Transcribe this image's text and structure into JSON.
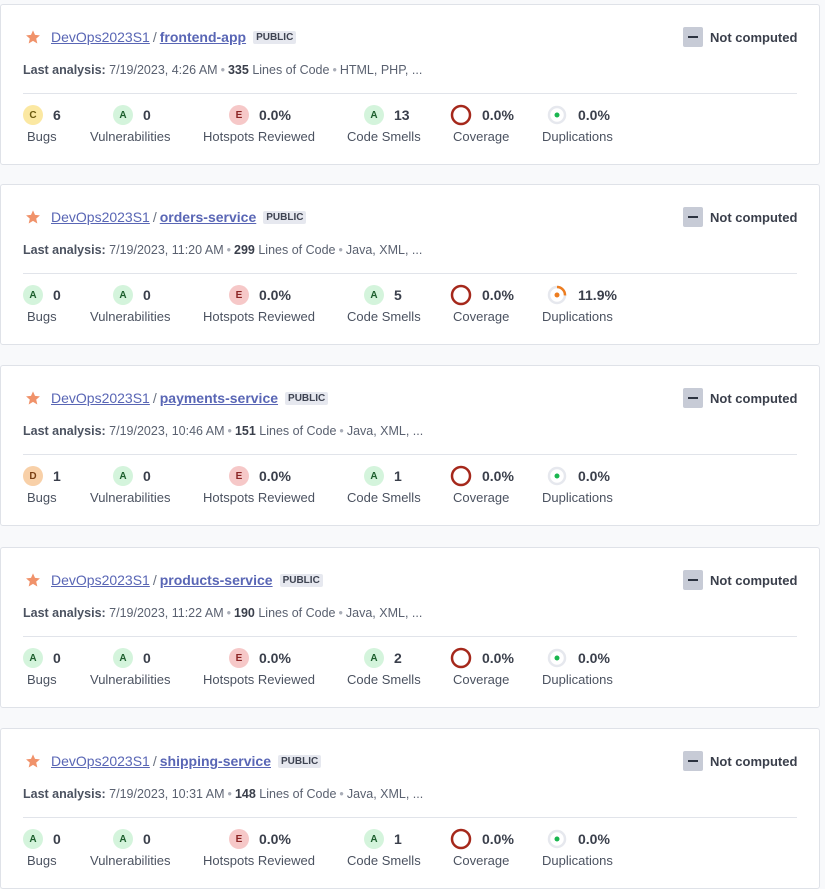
{
  "icons": {
    "favorite": "star-icon",
    "quality_gate": "minus-icon"
  },
  "colors": {
    "link": "#5966b5",
    "star": "#f0926a",
    "coverage": "#a5281b",
    "duplication_low": "#1ab64f",
    "duplication_warn": "#ed7d20"
  },
  "projects": [
    {
      "org": "DevOps2023S1",
      "name": "frontend-app",
      "visibility": "PUBLIC",
      "quality_gate": "Not computed",
      "last_label": "Last analysis:",
      "last": "7/19/2023, 4:26 AM",
      "loc": "335",
      "loc_label": "Lines of Code",
      "langs": "HTML, PHP, ...",
      "bugs_rating": "C",
      "bugs": "6",
      "bugs_label": "Bugs",
      "vuln_rating": "A",
      "vuln": "0",
      "vuln_label": "Vulnerabilities",
      "hot_rating": "E",
      "hot": "0.0%",
      "hot_label": "Hotspots Reviewed",
      "smell_rating": "A",
      "smell": "13",
      "smell_label": "Code Smells",
      "cov": "0.0%",
      "cov_label": "Coverage",
      "dup": "0.0%",
      "dup_pct": 0.0,
      "dup_label": "Duplications"
    },
    {
      "org": "DevOps2023S1",
      "name": "orders-service",
      "visibility": "PUBLIC",
      "quality_gate": "Not computed",
      "last_label": "Last analysis:",
      "last": "7/19/2023, 11:20 AM",
      "loc": "299",
      "loc_label": "Lines of Code",
      "langs": "Java, XML, ...",
      "bugs_rating": "A",
      "bugs": "0",
      "bugs_label": "Bugs",
      "vuln_rating": "A",
      "vuln": "0",
      "vuln_label": "Vulnerabilities",
      "hot_rating": "E",
      "hot": "0.0%",
      "hot_label": "Hotspots Reviewed",
      "smell_rating": "A",
      "smell": "5",
      "smell_label": "Code Smells",
      "cov": "0.0%",
      "cov_label": "Coverage",
      "dup": "11.9%",
      "dup_pct": 11.9,
      "dup_label": "Duplications"
    },
    {
      "org": "DevOps2023S1",
      "name": "payments-service",
      "visibility": "PUBLIC",
      "quality_gate": "Not computed",
      "last_label": "Last analysis:",
      "last": "7/19/2023, 10:46 AM",
      "loc": "151",
      "loc_label": "Lines of Code",
      "langs": "Java, XML, ...",
      "bugs_rating": "D",
      "bugs": "1",
      "bugs_label": "Bugs",
      "vuln_rating": "A",
      "vuln": "0",
      "vuln_label": "Vulnerabilities",
      "hot_rating": "E",
      "hot": "0.0%",
      "hot_label": "Hotspots Reviewed",
      "smell_rating": "A",
      "smell": "1",
      "smell_label": "Code Smells",
      "cov": "0.0%",
      "cov_label": "Coverage",
      "dup": "0.0%",
      "dup_pct": 0.0,
      "dup_label": "Duplications"
    },
    {
      "org": "DevOps2023S1",
      "name": "products-service",
      "visibility": "PUBLIC",
      "quality_gate": "Not computed",
      "last_label": "Last analysis:",
      "last": "7/19/2023, 11:22 AM",
      "loc": "190",
      "loc_label": "Lines of Code",
      "langs": "Java, XML, ...",
      "bugs_rating": "A",
      "bugs": "0",
      "bugs_label": "Bugs",
      "vuln_rating": "A",
      "vuln": "0",
      "vuln_label": "Vulnerabilities",
      "hot_rating": "E",
      "hot": "0.0%",
      "hot_label": "Hotspots Reviewed",
      "smell_rating": "A",
      "smell": "2",
      "smell_label": "Code Smells",
      "cov": "0.0%",
      "cov_label": "Coverage",
      "dup": "0.0%",
      "dup_pct": 0.0,
      "dup_label": "Duplications"
    },
    {
      "org": "DevOps2023S1",
      "name": "shipping-service",
      "visibility": "PUBLIC",
      "quality_gate": "Not computed",
      "last_label": "Last analysis:",
      "last": "7/19/2023, 10:31 AM",
      "loc": "148",
      "loc_label": "Lines of Code",
      "langs": "Java, XML, ...",
      "bugs_rating": "A",
      "bugs": "0",
      "bugs_label": "Bugs",
      "vuln_rating": "A",
      "vuln": "0",
      "vuln_label": "Vulnerabilities",
      "hot_rating": "E",
      "hot": "0.0%",
      "hot_label": "Hotspots Reviewed",
      "smell_rating": "A",
      "smell": "1",
      "smell_label": "Code Smells",
      "cov": "0.0%",
      "cov_label": "Coverage",
      "dup": "0.0%",
      "dup_pct": 0.0,
      "dup_label": "Duplications"
    }
  ]
}
